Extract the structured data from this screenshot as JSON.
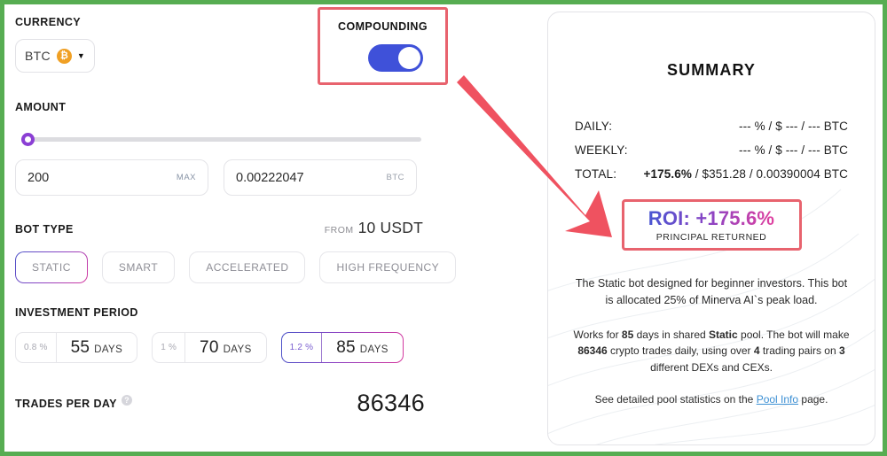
{
  "left": {
    "currency": {
      "label": "CURRENCY",
      "selected": "BTC",
      "icon": "bitcoin-icon",
      "icon_glyph": "₿",
      "chevron": "▼"
    },
    "amount": {
      "label": "AMOUNT",
      "slider_position_pct": 0,
      "fiat_value": "200",
      "fiat_suffix": "MAX",
      "crypto_value": "0.00222047",
      "crypto_suffix": "BTC"
    },
    "bot_type": {
      "label": "BOT TYPE",
      "from_label": "FROM",
      "from_value": "10 USDT",
      "options": [
        {
          "label": "STATIC",
          "selected": true
        },
        {
          "label": "SMART",
          "selected": false
        },
        {
          "label": "ACCELERATED",
          "selected": false
        },
        {
          "label": "HIGH FREQUENCY",
          "selected": false
        }
      ]
    },
    "investment_period": {
      "label": "INVESTMENT PERIOD",
      "unit": "DAYS",
      "options": [
        {
          "pct": "0.8 %",
          "days": "55",
          "selected": false
        },
        {
          "pct": "1 %",
          "days": "70",
          "selected": false
        },
        {
          "pct": "1.2 %",
          "days": "85",
          "selected": true
        }
      ]
    },
    "trades_per_day": {
      "label": "TRADES PER DAY",
      "help_icon": "question-mark-icon",
      "help_glyph": "?",
      "value": "86346"
    }
  },
  "compounding": {
    "label": "COMPOUNDING",
    "enabled": true,
    "highlight_color": "#e8636e",
    "toggle_color": "#3f51d9"
  },
  "arrow": {
    "color": "#ef5260",
    "points_from": "compounding-toggle",
    "points_to": "roi-box"
  },
  "summary": {
    "title": "SUMMARY",
    "rows": [
      {
        "key": "DAILY:",
        "value": "--- % / $ --- / --- BTC",
        "bold_part": ""
      },
      {
        "key": "WEEKLY:",
        "value": "--- % / $ --- / --- BTC",
        "bold_part": ""
      },
      {
        "key": "TOTAL:",
        "value": " / $351.28 / 0.00390004 BTC",
        "bold_part": "+175.6%"
      }
    ],
    "roi": {
      "main": "ROI: +175.6%",
      "sub": "PRINCIPAL RETURNED",
      "gradient_start": "#4a56d2",
      "gradient_mid": "#8b44c4",
      "gradient_end": "#e0409f"
    },
    "description_1": "The Static bot designed for beginner investors. This bot is allocated 25% of Minerva AI`s peak load.",
    "description_2": {
      "part1": "Works for ",
      "b1": "85",
      "part2": " days in shared ",
      "b2": "Static",
      "part3": " pool. The bot will make ",
      "b3": "86346",
      "part4": " crypto trades daily, using over ",
      "b4": "4",
      "part5": " trading pairs on ",
      "b5": "3",
      "part6": " different DEXs and CEXs."
    },
    "description_3": {
      "before": "See detailed pool statistics on the ",
      "link": "Pool Info",
      "after": " page."
    }
  }
}
